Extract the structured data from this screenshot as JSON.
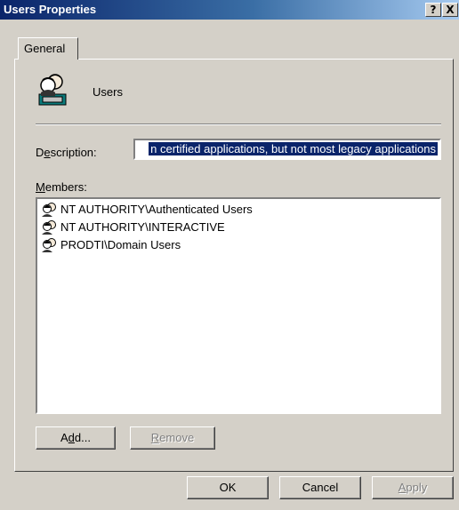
{
  "window": {
    "title": "Users Properties",
    "help_label": "?",
    "close_label": "X"
  },
  "tabs": [
    {
      "label": "General"
    }
  ],
  "group": {
    "icon": "users-group-icon",
    "name": "Users"
  },
  "description": {
    "label_before": "D",
    "label_access": "e",
    "label_after": "scription:",
    "value": "n certified applications, but not most legacy applications"
  },
  "members": {
    "label_access": "M",
    "label_after": "embers:",
    "items": [
      {
        "name": "NT AUTHORITY\\Authenticated Users",
        "icon": "group-icon"
      },
      {
        "name": "NT AUTHORITY\\INTERACTIVE",
        "icon": "group-icon"
      },
      {
        "name": "PRODTI\\Domain Users",
        "icon": "group-icon"
      }
    ]
  },
  "buttons": {
    "add_before": "A",
    "add_access": "d",
    "add_after": "d...",
    "remove_access": "R",
    "remove_after": "emove",
    "ok": "OK",
    "cancel": "Cancel",
    "apply_access": "A",
    "apply_after": "pply"
  },
  "colors": {
    "titlebar": "#0a246a",
    "selection": "#0a246a",
    "face": "#d4d0c8"
  }
}
